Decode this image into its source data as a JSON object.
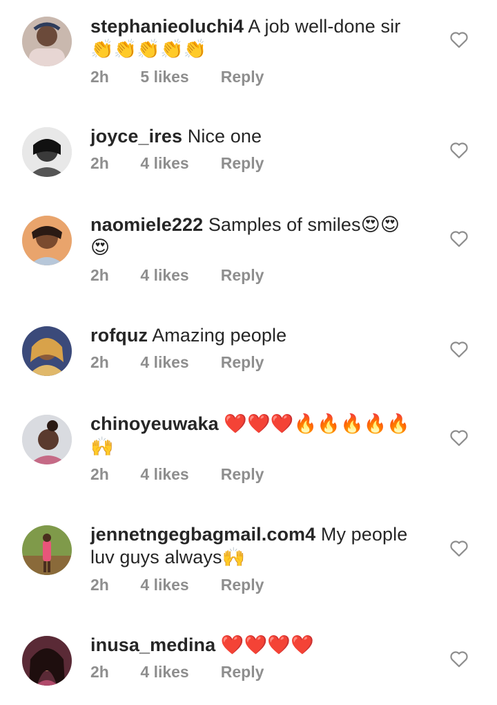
{
  "comments": [
    {
      "user": "stephanieoluchi4",
      "text": "A job well-done sir👏👏👏👏👏",
      "time": "2h",
      "likes": "5 likes",
      "reply": "Reply"
    },
    {
      "user": "joyce_ires",
      "text": "Nice one",
      "time": "2h",
      "likes": "4 likes",
      "reply": "Reply"
    },
    {
      "user": "naomiele222",
      "text": "Samples of smiles😍😍😍",
      "time": "2h",
      "likes": "4 likes",
      "reply": "Reply"
    },
    {
      "user": "rofquz",
      "text": "Amazing people",
      "time": "2h",
      "likes": "4 likes",
      "reply": "Reply"
    },
    {
      "user": "chinoyeuwaka",
      "text": "❤️❤️❤️🔥🔥🔥🔥🔥🙌",
      "time": "2h",
      "likes": "4 likes",
      "reply": "Reply"
    },
    {
      "user": "jennetngegbagmail.com4",
      "text": "My people luv guys always🙌",
      "time": "2h",
      "likes": "4 likes",
      "reply": "Reply"
    },
    {
      "user": "inusa_medina",
      "text": "❤️❤️❤️❤️",
      "time": "2h",
      "likes": "4 likes",
      "reply": "Reply"
    }
  ],
  "icons": {
    "like": "heart-outline-icon"
  },
  "colors": {
    "text": "#262626",
    "meta": "#8e8e8e",
    "background": "#ffffff"
  }
}
